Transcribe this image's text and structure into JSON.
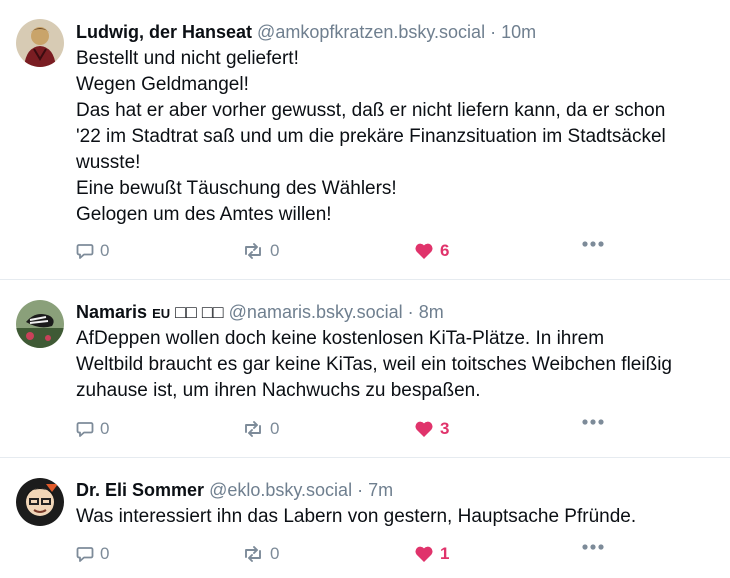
{
  "posts": [
    {
      "author": "Ludwig, der Hanseat",
      "badge": "",
      "handle": "@amkopfkratzen.bsky.social",
      "separator": "·",
      "time": "10m",
      "lines": [
        "Bestellt und nicht geliefert!",
        "Wegen Geldmangel!",
        "Das hat er aber vorher gewusst, daß er nicht liefern kann, da er schon",
        "'22 im Stadtrat saß und um die prekäre Finanzsituation im Stadtsäckel",
        "wusste!",
        "Eine bewußt Täuschung des Wählers!",
        "Gelogen um des Amtes willen!"
      ],
      "replies": "0",
      "reposts": "0",
      "likes": "6"
    },
    {
      "author": "Namaris",
      "badge": "EU",
      "flags": "□□ □□",
      "handle": "@namaris.bsky.social",
      "separator": "·",
      "time": "8m",
      "lines": [
        "AfDeppen wollen doch keine kostenlosen KiTa-Plätze. In ihrem",
        "Weltbild braucht es gar keine KiTas, weil ein toitsches Weibchen fleißig",
        "zuhause ist, um ihren Nachwuchs zu bespaßen."
      ],
      "replies": "0",
      "reposts": "0",
      "likes": "3"
    },
    {
      "author": "Dr. Eli Sommer",
      "badge": "",
      "handle": "@eklo.bsky.social",
      "separator": "·",
      "time": "7m",
      "lines": [
        "Was interessiert ihn das Labern von gestern, Hauptsache Pfründe."
      ],
      "replies": "0",
      "reposts": "0",
      "likes": "1"
    }
  ],
  "colors": {
    "like": "#e0336b",
    "muted": "#6f7f8f",
    "icon": "#7d8b99",
    "divider": "#e6ebf0"
  },
  "icons": [
    "reply-icon",
    "repost-icon",
    "heart-icon",
    "more-icon"
  ]
}
